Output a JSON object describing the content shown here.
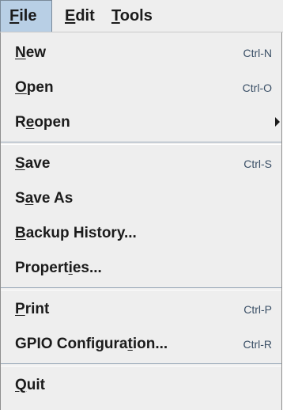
{
  "menubar": {
    "items": [
      {
        "label": "File",
        "mnemonic_index": 0,
        "active": true
      },
      {
        "label": "Edit",
        "mnemonic_index": 0,
        "active": false
      },
      {
        "label": "Tools",
        "mnemonic_index": 0,
        "active": false
      }
    ]
  },
  "file_menu": {
    "items": [
      {
        "label": "New",
        "mnemonic_index": 0,
        "shortcut": "Ctrl-N"
      },
      {
        "label": "Open",
        "mnemonic_index": 0,
        "shortcut": "Ctrl-O"
      },
      {
        "label": "Reopen",
        "mnemonic_index": 1,
        "shortcut": "",
        "submenu": true
      },
      {
        "label": "Save",
        "mnemonic_index": 0,
        "shortcut": "Ctrl-S"
      },
      {
        "label": "Save As",
        "mnemonic_index": 1,
        "shortcut": ""
      },
      {
        "label": "Backup History...",
        "mnemonic_index": 0,
        "shortcut": ""
      },
      {
        "label": "Properties...",
        "mnemonic_index": 7,
        "shortcut": ""
      },
      {
        "label": "Print",
        "mnemonic_index": 0,
        "shortcut": "Ctrl-P"
      },
      {
        "label": "GPIO Configuration...",
        "mnemonic_index": 14,
        "shortcut": "Ctrl-R"
      },
      {
        "label": "Quit",
        "mnemonic_index": 0,
        "shortcut": ""
      }
    ]
  },
  "colors": {
    "menu_background": "#eeeeee",
    "active_menu_highlight": "#b8cfe5",
    "shortcut_text": "#3a4f66",
    "label_text": "#1b1b1b"
  }
}
